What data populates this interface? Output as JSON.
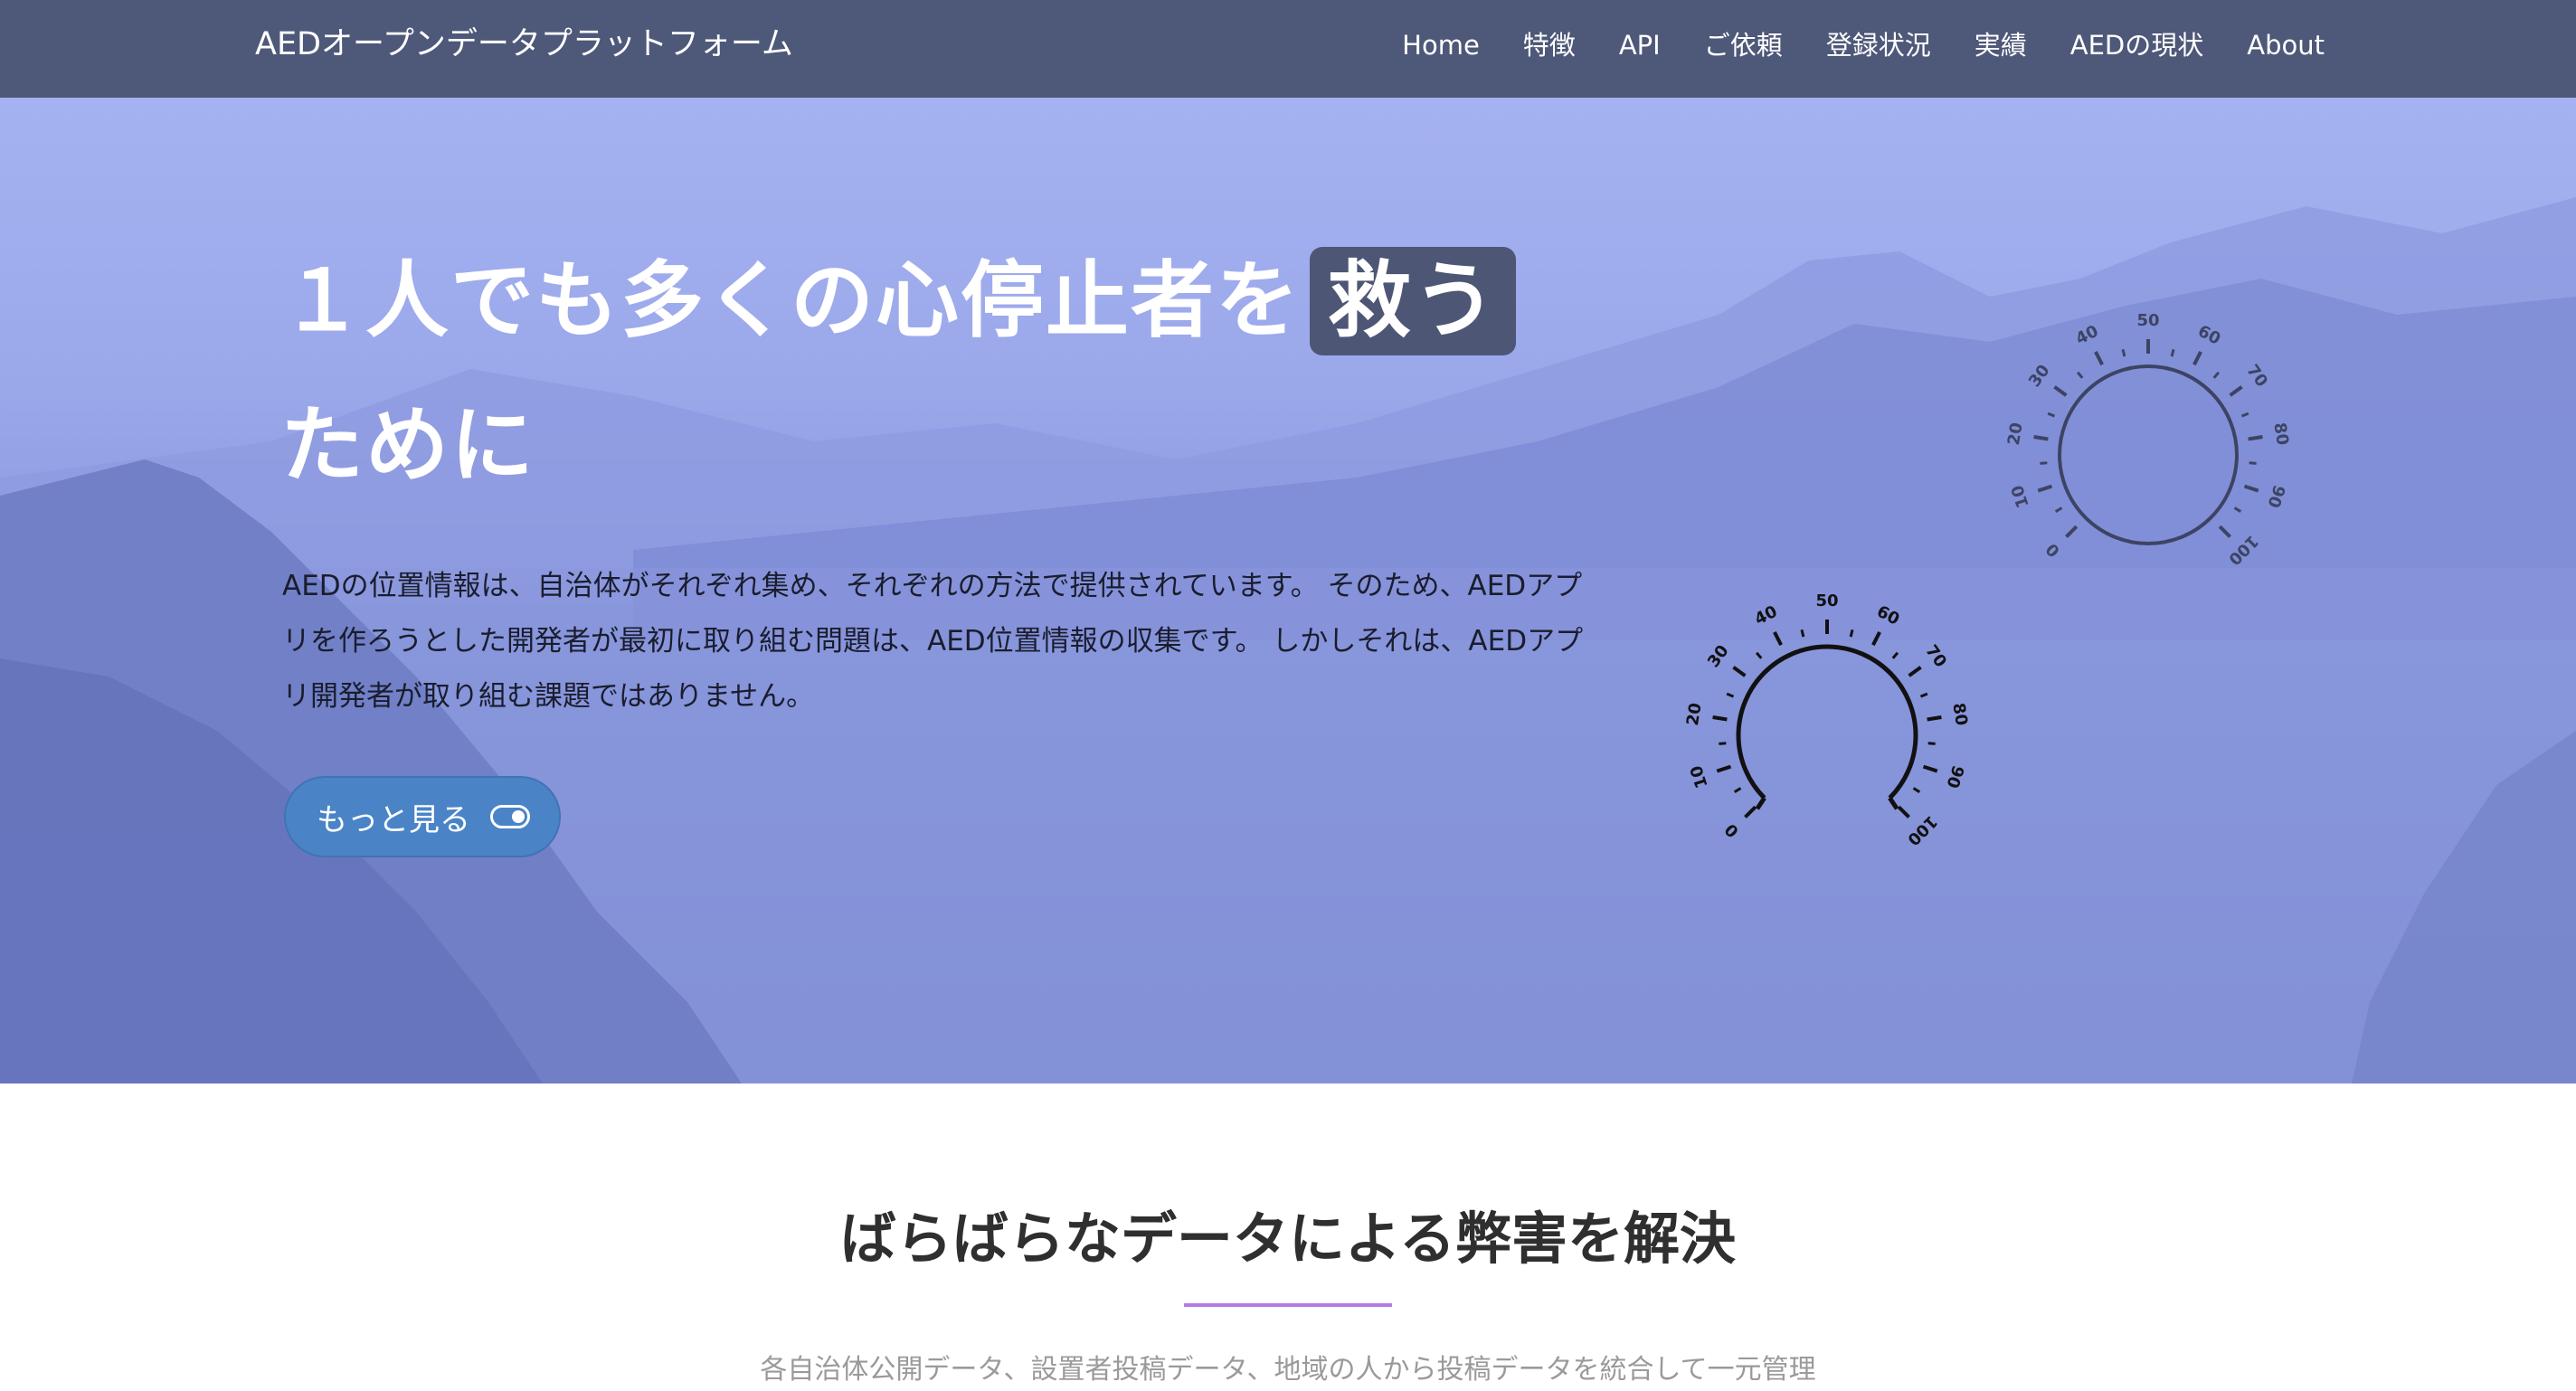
{
  "navbar": {
    "brand": "AEDオープンデータプラットフォーム",
    "links": [
      "Home",
      "特徴",
      "API",
      "ご依頼",
      "登録状況",
      "実績",
      "AEDの現状",
      "About"
    ]
  },
  "hero": {
    "title_before": "１人でも多くの心停止者を",
    "title_highlight": "救う",
    "title_after": "ために",
    "description": "AEDの位置情報は、自治体がそれぞれ集め、それぞれの方法で提供されています。 そのため、AEDアプリを作ろうとした開発者が最初に取り組む問題は、AED位置情報の収集です。 しかしそれは、AEDアプリ開発者が取り組む課題ではありません。",
    "button_label": "もっと見る",
    "button_icon": "toggle-on-icon"
  },
  "gauges": [
    {
      "scale_labels": [
        "0",
        "10",
        "20",
        "30",
        "40",
        "50",
        "60",
        "70",
        "80",
        "90",
        "100"
      ]
    },
    {
      "scale_labels": [
        "0",
        "10",
        "20",
        "30",
        "40",
        "50",
        "60",
        "70",
        "80",
        "90",
        "100"
      ]
    }
  ],
  "section": {
    "title": "ばらばらなデータによる弊害を解決",
    "subtitle": "各自治体公開データ、設置者投稿データ、地域の人から投稿データを統合して一元管理"
  },
  "colors": {
    "navbar": "#4e5878",
    "hero_overlay": "#9aa8ea",
    "highlight": "#4e5675",
    "button": "#4a84c7",
    "divider": "#b57be0"
  }
}
